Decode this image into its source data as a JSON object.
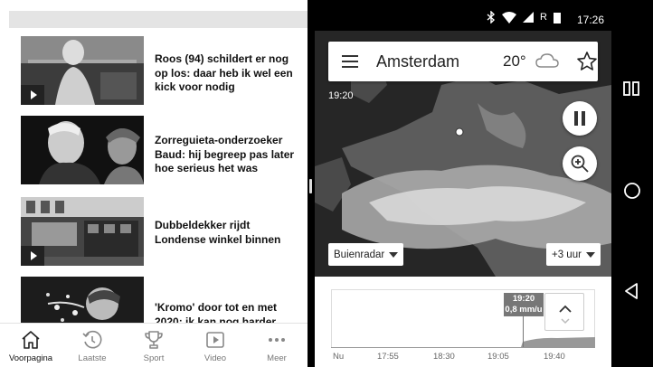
{
  "news": {
    "articles": [
      {
        "headline": "Roos (94) schildert er nog op los: daar heb ik wel een kick voor nodig",
        "video": true
      },
      {
        "headline": "Zorreguieta-onderzoeker Baud: hij begreep pas later hoe serieus het was",
        "video": false
      },
      {
        "headline": "Dubbeldekker rijdt Londense winkel binnen",
        "video": true
      },
      {
        "headline": "'Kromo' door tot en met 2020: ik kan nog harder",
        "video": false
      }
    ],
    "nav": [
      {
        "label": "Voorpagina",
        "icon": "home-icon"
      },
      {
        "label": "Laatste",
        "icon": "clock-refresh-icon"
      },
      {
        "label": "Sport",
        "icon": "trophy-icon"
      },
      {
        "label": "Video",
        "icon": "video-play-icon"
      },
      {
        "label": "Meer",
        "icon": "more-dots-icon"
      }
    ]
  },
  "status_bar": {
    "carrier": "R",
    "time": "17:26"
  },
  "weather": {
    "city": "Amsterdam",
    "temperature": "20°",
    "map_time": "19:20",
    "source_dropdown": "Buienradar",
    "range_dropdown": "+3 uur",
    "tooltip_time": "19:20",
    "tooltip_value": "0,8 mm/u",
    "axis_labels": [
      "Nu",
      "17:55",
      "18:30",
      "19:05",
      "19:40"
    ]
  },
  "colors": {
    "nav_active": "#111111",
    "nav_inactive": "#777777",
    "tooltip": "#777777"
  }
}
